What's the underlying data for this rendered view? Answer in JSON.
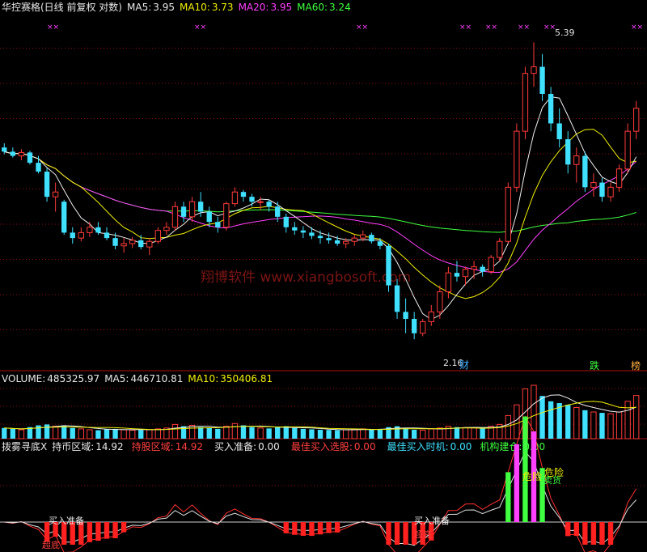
{
  "header": {
    "stock": "华控赛格(日线 前复权 对数)",
    "ma5_label": "MA5:",
    "ma5": "3.95",
    "ma10_label": "MA10:",
    "ma10": "3.73",
    "ma20_label": "MA20:",
    "ma20": "3.95",
    "ma60_label": "MA60:",
    "ma60": "3.24"
  },
  "watermark": "翔博软件 www.xiangbosoft.com",
  "price_panel": {
    "high_label": "5.39",
    "low_label": "2.16",
    "signals": [
      {
        "text": "财",
        "color": "#40b0ff"
      },
      {
        "text": "跌",
        "color": "#40ff40"
      },
      {
        "text": "榜",
        "color": "#ffb040"
      }
    ]
  },
  "volume_header": {
    "label": "VOLUME:",
    "volume": "485325.97",
    "ma5_label": "MA5:",
    "ma5": "446710.81",
    "ma10_label": "MA10:",
    "ma10": "350406.81"
  },
  "indicator_header": {
    "name": "拨雾寻底X",
    "hold_zone_label": "持币区域:",
    "hold_zone": "14.92",
    "stock_zone_label": "持股区域:",
    "stock_zone": "14.92",
    "buy_prep_label": "买入准备:",
    "buy_prep": "0.00",
    "best_buy_pick_label": "最佳买入选股:",
    "best_buy_pick": "0.00",
    "best_buy_time_label": "最佳买入时机:",
    "best_buy_time": "0.00",
    "inst_label": "机构建仓:",
    "inst": "0.00"
  },
  "indicator_labels": {
    "buy_prep_1": "买入准备",
    "bottom_1": "超底",
    "buy_prep_2": "买入准备",
    "bottom_2": "超底",
    "danger_1": "危险",
    "danger_2": "危险",
    "sell": "卖货"
  },
  "colors": {
    "up": "#ff3b3b",
    "down": "#40e0ff",
    "ma5": "#f0f0f0",
    "ma10": "#f0f000",
    "ma20": "#ff40ff",
    "ma60": "#40ff40",
    "grid": "#8b1010"
  },
  "chart_data": {
    "type": "candlestick",
    "price_scale": "log",
    "ylim": [
      2.0,
      5.7
    ],
    "candles": [
      [
        3.9,
        3.95,
        3.82,
        3.85
      ],
      [
        3.85,
        3.9,
        3.78,
        3.8
      ],
      [
        3.8,
        3.88,
        3.75,
        3.84
      ],
      [
        3.84,
        3.86,
        3.7,
        3.72
      ],
      [
        3.72,
        3.8,
        3.6,
        3.62
      ],
      [
        3.62,
        3.66,
        3.3,
        3.35
      ],
      [
        3.35,
        3.5,
        3.2,
        3.4
      ],
      [
        3.3,
        3.32,
        2.98,
        3.0
      ],
      [
        3.0,
        3.05,
        2.9,
        2.95
      ],
      [
        2.95,
        3.05,
        2.92,
        3.0
      ],
      [
        3.0,
        3.1,
        2.96,
        3.05
      ],
      [
        3.05,
        3.1,
        2.98,
        3.0
      ],
      [
        3.0,
        3.05,
        2.93,
        2.95
      ],
      [
        2.95,
        3.0,
        2.85,
        2.88
      ],
      [
        2.88,
        2.95,
        2.82,
        2.9
      ],
      [
        2.9,
        2.96,
        2.86,
        2.93
      ],
      [
        2.93,
        2.98,
        2.85,
        2.87
      ],
      [
        2.87,
        2.95,
        2.8,
        2.92
      ],
      [
        2.92,
        3.05,
        2.9,
        3.02
      ],
      [
        3.02,
        3.1,
        2.98,
        3.05
      ],
      [
        3.05,
        3.3,
        3.02,
        3.25
      ],
      [
        3.25,
        3.3,
        3.1,
        3.15
      ],
      [
        3.15,
        3.35,
        3.1,
        3.3
      ],
      [
        3.3,
        3.4,
        3.15,
        3.2
      ],
      [
        3.2,
        3.25,
        3.05,
        3.1
      ],
      [
        3.1,
        3.15,
        3.0,
        3.05
      ],
      [
        3.05,
        3.3,
        3.02,
        3.28
      ],
      [
        3.28,
        3.45,
        3.25,
        3.4
      ],
      [
        3.4,
        3.42,
        3.3,
        3.35
      ],
      [
        3.35,
        3.38,
        3.25,
        3.3
      ],
      [
        3.3,
        3.35,
        3.22,
        3.3
      ],
      [
        3.3,
        3.32,
        3.2,
        3.25
      ],
      [
        3.25,
        3.3,
        3.1,
        3.15
      ],
      [
        3.15,
        3.18,
        3.0,
        3.05
      ],
      [
        3.05,
        3.1,
        2.98,
        3.02
      ],
      [
        3.02,
        3.06,
        2.95,
        3.0
      ],
      [
        3.0,
        3.05,
        2.94,
        2.97
      ],
      [
        2.97,
        3.02,
        2.9,
        2.95
      ],
      [
        2.95,
        3.0,
        2.9,
        2.93
      ],
      [
        2.93,
        2.97,
        2.88,
        2.9
      ],
      [
        2.9,
        2.95,
        2.86,
        2.92
      ],
      [
        2.92,
        2.98,
        2.88,
        2.95
      ],
      [
        2.95,
        3.02,
        2.92,
        2.98
      ],
      [
        2.98,
        3.0,
        2.9,
        2.92
      ],
      [
        2.92,
        2.95,
        2.85,
        2.88
      ],
      [
        2.88,
        2.9,
        2.5,
        2.55
      ],
      [
        2.55,
        2.6,
        2.3,
        2.35
      ],
      [
        2.35,
        2.45,
        2.2,
        2.3
      ],
      [
        2.3,
        2.35,
        2.16,
        2.2
      ],
      [
        2.2,
        2.3,
        2.18,
        2.28
      ],
      [
        2.28,
        2.4,
        2.25,
        2.35
      ],
      [
        2.35,
        2.55,
        2.3,
        2.5
      ],
      [
        2.5,
        2.7,
        2.45,
        2.65
      ],
      [
        2.65,
        2.75,
        2.58,
        2.62
      ],
      [
        2.62,
        2.7,
        2.55,
        2.68
      ],
      [
        2.68,
        2.75,
        2.6,
        2.7
      ],
      [
        2.7,
        2.72,
        2.62,
        2.66
      ],
      [
        2.66,
        2.8,
        2.64,
        2.78
      ],
      [
        2.78,
        2.95,
        2.75,
        2.92
      ],
      [
        2.92,
        3.5,
        2.9,
        3.45
      ],
      [
        3.45,
        4.2,
        3.4,
        4.1
      ],
      [
        4.1,
        5.0,
        4.0,
        4.9
      ],
      [
        4.9,
        5.39,
        4.7,
        5.0
      ],
      [
        5.0,
        5.2,
        4.5,
        4.6
      ],
      [
        4.6,
        4.7,
        4.1,
        4.2
      ],
      [
        4.2,
        4.4,
        3.9,
        4.0
      ],
      [
        4.0,
        4.1,
        3.6,
        3.7
      ],
      [
        3.7,
        3.9,
        3.5,
        3.8
      ],
      [
        3.8,
        3.85,
        3.4,
        3.45
      ],
      [
        3.45,
        3.6,
        3.35,
        3.5
      ],
      [
        3.5,
        3.55,
        3.3,
        3.35
      ],
      [
        3.35,
        3.5,
        3.3,
        3.45
      ],
      [
        3.45,
        3.7,
        3.4,
        3.65
      ],
      [
        3.65,
        4.2,
        3.6,
        4.1
      ],
      [
        4.1,
        4.5,
        4.0,
        4.4
      ]
    ],
    "volume_scale": [
      0,
      600000
    ],
    "volume": [
      120000,
      110000,
      100000,
      130000,
      150000,
      160000,
      140000,
      150000,
      120000,
      110000,
      100000,
      95000,
      105000,
      110000,
      100000,
      95000,
      98000,
      102000,
      110000,
      120000,
      160000,
      140000,
      150000,
      130000,
      120000,
      110000,
      140000,
      170000,
      150000,
      130000,
      120000,
      115000,
      130000,
      140000,
      120000,
      110000,
      105000,
      100000,
      98000,
      95000,
      100000,
      105000,
      110000,
      100000,
      110000,
      130000,
      140000,
      120000,
      100000,
      95000,
      110000,
      120000,
      140000,
      130000,
      125000,
      120000,
      115000,
      140000,
      160000,
      260000,
      380000,
      560000,
      600000,
      480000,
      420000,
      400000,
      380000,
      350000,
      320000,
      300000,
      290000,
      280000,
      300000,
      420000,
      485326
    ]
  }
}
